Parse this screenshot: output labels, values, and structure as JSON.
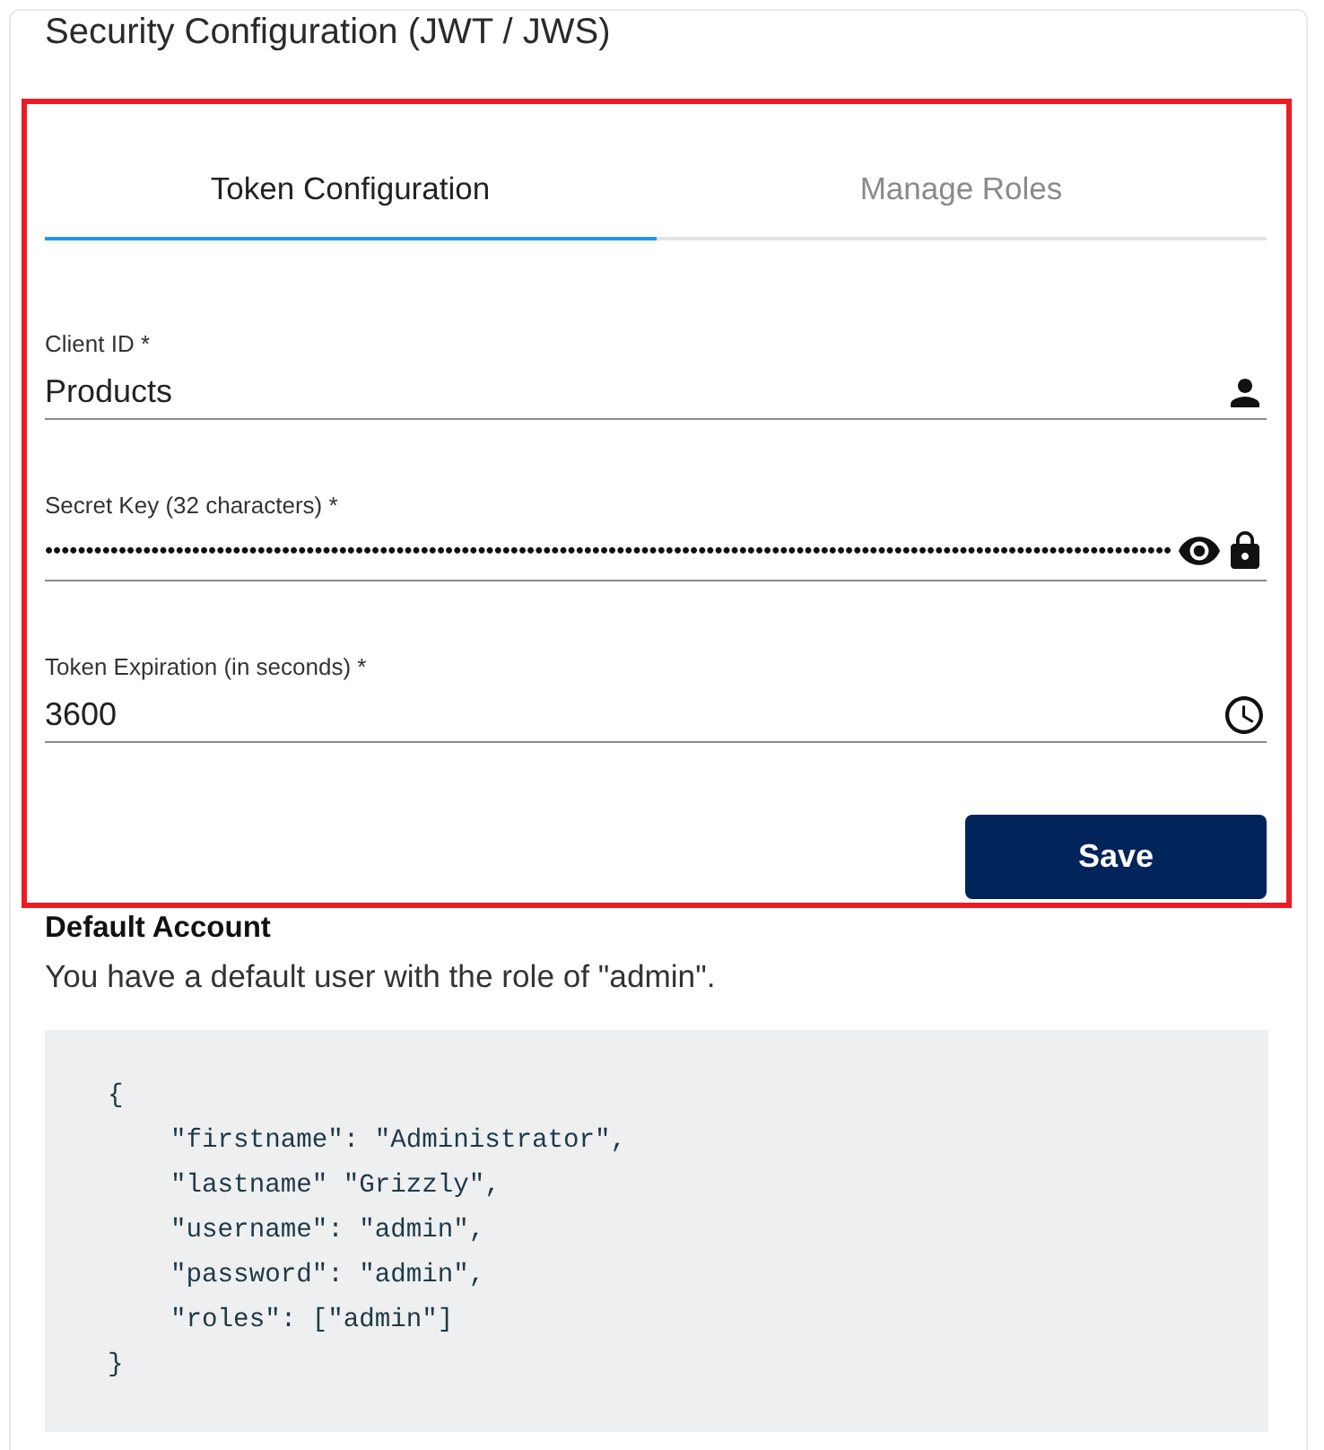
{
  "card": {
    "title": "Security Configuration (JWT / JWS)"
  },
  "tabs": [
    {
      "label": "Token Configuration",
      "selected": true
    },
    {
      "label": "Manage Roles",
      "selected": false
    }
  ],
  "fields": [
    {
      "kind": "user",
      "label": "Client ID *",
      "value": "Products"
    },
    {
      "kind": "secret",
      "label": "Secret Key (32 characters) *",
      "value": "••••••••••••••••••••••••••••••••••••••••••••••••••••••••••••••••••••••••••••••••••••••••••••••••••••••••••••••••••••••••••••••••••••••••••"
    },
    {
      "kind": "duration",
      "label": "Token Expiration (in seconds) *",
      "value": "3600"
    }
  ],
  "save_button": {
    "label": "Save"
  },
  "default_account": {
    "heading": "Default Account",
    "description": "You have a default user with the role of \"admin\".",
    "code_lines": [
      "{",
      "    \"firstname\": \"Administrator\",",
      "    \"lastname\" \"Grizzly\",",
      "    \"username\": \"admin\",",
      "    \"password\": \"admin\",",
      "    \"roles\": [\"admin\"]",
      "}"
    ]
  }
}
